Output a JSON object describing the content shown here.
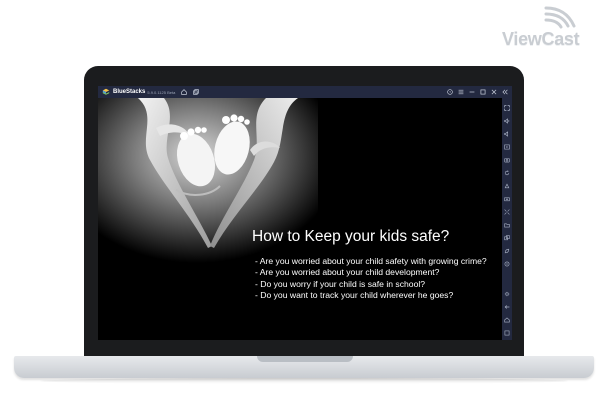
{
  "watermark": {
    "text": "ViewCast"
  },
  "window": {
    "app_name": "BlueStacks",
    "version": "5.9.0.1125 Beta"
  },
  "titlebar_icons": [
    "bluestacks-logo-icon",
    "home-icon",
    "multi-instance-icon",
    "help-icon",
    "menu-icon",
    "minimize-icon",
    "maximize-icon",
    "close-icon",
    "collapse-icon"
  ],
  "sidebar_icons": [
    "fullscreen-icon",
    "volume-up-icon",
    "volume-down-icon",
    "screen-record-icon",
    "screenshot-icon",
    "rotate-icon",
    "shake-icon",
    "camera-icon",
    "macro-icon",
    "folder-icon",
    "multi-instance-icon",
    "eco-mode-icon",
    "location-icon",
    "settings-icon",
    "back-icon",
    "home-icon",
    "recent-apps-icon"
  ],
  "content": {
    "headline": "How to Keep your kids safe?",
    "bullets": [
      "- Are you worried about your child safety with growing crime?",
      "- Are you worried about your child development?",
      "- Do you worry if your child is safe in school?",
      "- Do you want to track your child wherever he goes?"
    ]
  },
  "colors": {
    "titlebar": "#232940",
    "laptop_bezel": "#1b1c1e",
    "screen_background": "#000000",
    "text": "#ffffff"
  }
}
